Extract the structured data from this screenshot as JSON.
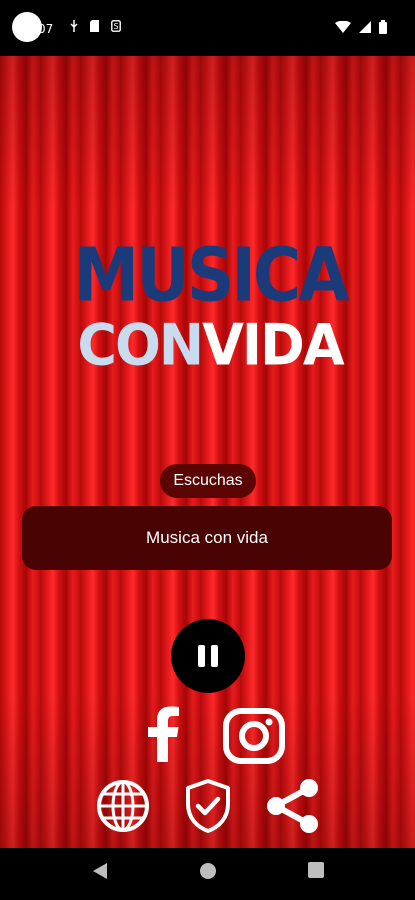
{
  "status_bar": {
    "time": "07",
    "icons_left": [
      "usb-icon",
      "sd-card-icon",
      "sim-icon"
    ],
    "icons_right": [
      "wifi-icon",
      "signal-icon",
      "battery-icon"
    ]
  },
  "logo": {
    "line1": "MUSICA",
    "line2_a": "CON",
    "line2_b": "VIDA"
  },
  "listeners": {
    "label": "Escuchas"
  },
  "now_playing": {
    "title": "Musica con vida"
  },
  "player": {
    "state": "playing",
    "button_icon": "pause-icon"
  },
  "social": [
    "facebook-icon",
    "instagram-icon"
  ],
  "links": [
    "globe-icon",
    "privacy-shield-icon",
    "share-icon"
  ],
  "nav": [
    "back-icon",
    "home-icon",
    "recents-icon"
  ],
  "colors": {
    "curtain": "#e0181a",
    "dark_panel": "#4a0303",
    "logo_blue": "#1b3a7a",
    "logo_light": "#c9dcef"
  }
}
